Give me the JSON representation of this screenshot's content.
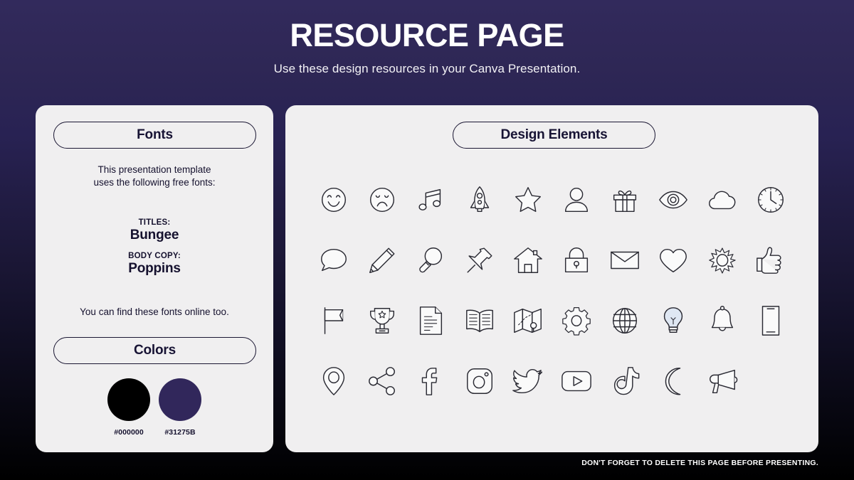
{
  "header": {
    "title": "RESOURCE PAGE",
    "subtitle": "Use these design resources in your Canva Presentation."
  },
  "fonts_panel": {
    "heading": "Fonts",
    "intro_line_1": "This presentation template",
    "intro_line_2": "uses the following free fonts:",
    "titles_label": "TITLES:",
    "titles_font": "Bungee",
    "body_label": "BODY COPY:",
    "body_font": "Poppins",
    "outro": "You can find these fonts online too."
  },
  "colors_panel": {
    "heading": "Colors",
    "swatches": [
      {
        "hex": "#000000",
        "label": "#000000"
      },
      {
        "hex": "#31275B",
        "label": "#31275B"
      }
    ]
  },
  "design_panel": {
    "heading": "Design Elements",
    "icons": [
      {
        "name": "smiley-face-icon"
      },
      {
        "name": "sad-face-icon"
      },
      {
        "name": "music-note-icon"
      },
      {
        "name": "rocket-icon"
      },
      {
        "name": "star-icon"
      },
      {
        "name": "person-icon"
      },
      {
        "name": "gift-icon"
      },
      {
        "name": "eye-icon"
      },
      {
        "name": "cloud-icon"
      },
      {
        "name": "clock-icon"
      },
      {
        "name": "speech-bubble-icon"
      },
      {
        "name": "pencil-icon"
      },
      {
        "name": "magnifier-icon"
      },
      {
        "name": "pushpin-icon"
      },
      {
        "name": "house-icon"
      },
      {
        "name": "lock-icon"
      },
      {
        "name": "envelope-icon"
      },
      {
        "name": "heart-icon"
      },
      {
        "name": "sun-icon"
      },
      {
        "name": "thumbs-up-icon"
      },
      {
        "name": "flag-icon"
      },
      {
        "name": "trophy-icon"
      },
      {
        "name": "document-icon"
      },
      {
        "name": "open-book-icon"
      },
      {
        "name": "map-icon"
      },
      {
        "name": "gear-icon"
      },
      {
        "name": "globe-icon"
      },
      {
        "name": "lightbulb-icon"
      },
      {
        "name": "bell-icon"
      },
      {
        "name": "phone-icon"
      },
      {
        "name": "location-pin-icon"
      },
      {
        "name": "share-icon"
      },
      {
        "name": "facebook-icon"
      },
      {
        "name": "instagram-icon"
      },
      {
        "name": "twitter-icon"
      },
      {
        "name": "youtube-icon"
      },
      {
        "name": "tiktok-icon"
      },
      {
        "name": "moon-icon"
      },
      {
        "name": "megaphone-icon"
      }
    ]
  },
  "footer": {
    "note": "DON'T FORGET TO DELETE THIS PAGE BEFORE PRESENTING."
  },
  "theme": {
    "background_top": "#322A5C",
    "background_bottom": "#000000",
    "panel_bg": "#F0EFF0",
    "ink": "#171334",
    "icon_stroke": "#2A2A33",
    "bulb_tint": "#DFE7F3"
  }
}
